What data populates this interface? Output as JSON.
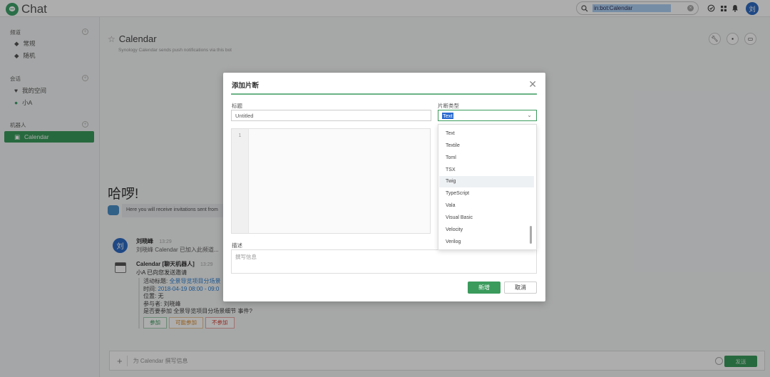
{
  "app": {
    "name": "Chat",
    "brand_color": "#3a9b5c"
  },
  "search": {
    "value": "in:bot:Calendar",
    "clear": "×"
  },
  "user": {
    "avatar_initial": "刘"
  },
  "sidebar": {
    "sections": [
      {
        "label": "频道",
        "items": [
          "常规",
          "随机"
        ]
      },
      {
        "label": "会话",
        "items": [
          "我的空间",
          "小A"
        ]
      },
      {
        "label": "机器人",
        "items": [
          "Calendar"
        ]
      }
    ]
  },
  "channel": {
    "title": "Calendar",
    "description": "Synology Calendar sends push notifications via this bot"
  },
  "welcome": {
    "greeting": "哈啰!",
    "bot_note": "Here you will receive invitations sent from"
  },
  "messages": [
    {
      "author": "刘晓峰",
      "time": "13:29",
      "text": "刘晓峰 Calendar 已加入此频道..."
    },
    {
      "author": "Calendar [聊天机器人]",
      "time": "13:29",
      "text": "小A 已向您发送邀请"
    }
  ],
  "event": {
    "title_label": "活动标题: ",
    "title_value": "全景导览项目分场景",
    "time_label": "时间: ",
    "time_value": "2018-04-19 08:00 - 09:0",
    "location": "位置: 无",
    "participants": "参与者: 刘晓峰",
    "question": "是否要参加 全景导览项目分场景细节 事件?",
    "buttons": [
      "参加",
      "可能参加",
      "不参加"
    ]
  },
  "composer": {
    "placeholder": "为 Calendar 撰写信息",
    "send_label": "发送"
  },
  "modal": {
    "title": "添加片断",
    "title_label": "标题",
    "title_value": "Untitled",
    "type_label": "片断类型",
    "type_value": "Text",
    "line_number": "1",
    "desc_label": "描述",
    "desc_placeholder": "撰写信息",
    "add_label": "新增",
    "cancel_label": "取消"
  },
  "dropdown": {
    "items": [
      "Text",
      "Textile",
      "Toml",
      "TSX",
      "Twig",
      "TypeScript",
      "Vala",
      "Visual Basic",
      "Velocity",
      "Verilog"
    ],
    "highlighted": "Twig"
  }
}
